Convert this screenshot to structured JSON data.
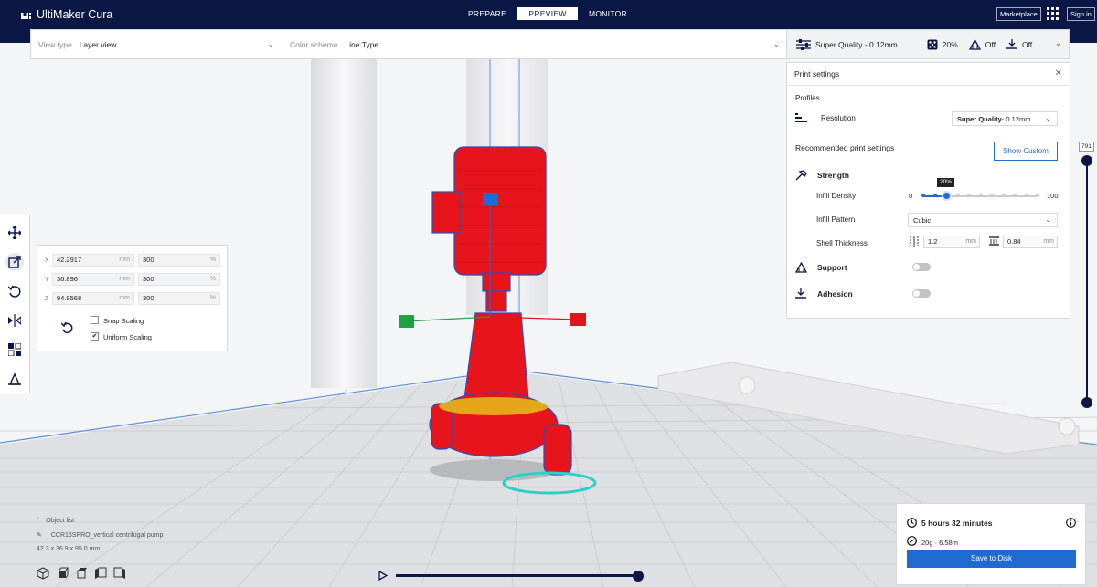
{
  "app": {
    "title": "UltiMaker Cura",
    "tabs": [
      {
        "label": "PREPARE",
        "active": false
      },
      {
        "label": "PREVIEW",
        "active": true
      },
      {
        "label": "MONITOR",
        "active": false
      }
    ],
    "marketplace_label": "Marketplace",
    "signin_label": "Sign in"
  },
  "toolbar": {
    "view_type_label": "View type",
    "view_type_value": "Layer view",
    "color_scheme_label": "Color scheme",
    "color_scheme_value": "Line Type",
    "quality_label": "Super Quality - 0.12mm",
    "infill_label": "20%",
    "support_label": "Off",
    "adhesion_label": "Off"
  },
  "print_settings": {
    "title": "Print settings",
    "profiles_label": "Profiles",
    "resolution_label": "Resolution",
    "resolution_value_bold": "Super Quality",
    "resolution_value_rest": " - 0.12mm",
    "recommended_label": "Recommended print settings",
    "show_custom_label": "Show Custom",
    "strength_label": "Strength",
    "infill_density_label": "Infill Density",
    "infill_min": "0",
    "infill_max": "100",
    "infill_value": 20,
    "infill_tooltip": "20%",
    "infill_pattern_label": "Infill Pattern",
    "infill_pattern_value": "Cubic",
    "shell_thickness_label": "Shell Thickness",
    "wall_thickness": "1.2",
    "top_bottom_thickness": "0.84",
    "unit_mm": "mm",
    "support_label": "Support",
    "support_enabled": false,
    "adhesion_label": "Adhesion",
    "adhesion_enabled": false
  },
  "scale_panel": {
    "x_label": "X",
    "x_mm": "42.2917",
    "x_pct": "300",
    "y_label": "Y",
    "y_mm": "36.896",
    "y_pct": "300",
    "z_label": "Z",
    "z_mm": "94.9568",
    "z_pct": "300",
    "unit_mm": "mm",
    "unit_pct": "%",
    "snap_scaling_label": "Snap Scaling",
    "snap_scaling_checked": false,
    "uniform_scaling_label": "Uniform Scaling",
    "uniform_scaling_checked": true
  },
  "layer_slider": {
    "value_label": "791"
  },
  "object_list": {
    "header": "Object list",
    "object_name": "CCR16SPRO_vertical centrifugal pump",
    "dimensions": "42.3 x 36.9 x 95.0 mm"
  },
  "estimate": {
    "time": "5 hours 32 minutes",
    "material": "20g · 6.58m",
    "save_label": "Save to Disk"
  },
  "colors": {
    "header_bg": "#0b1846",
    "accent": "#1f6bd0",
    "model_red": "#e8141b",
    "gizmo_green": "#1fa342",
    "gizmo_red": "#e0161f",
    "gizmo_blue": "#1f6bd0"
  }
}
